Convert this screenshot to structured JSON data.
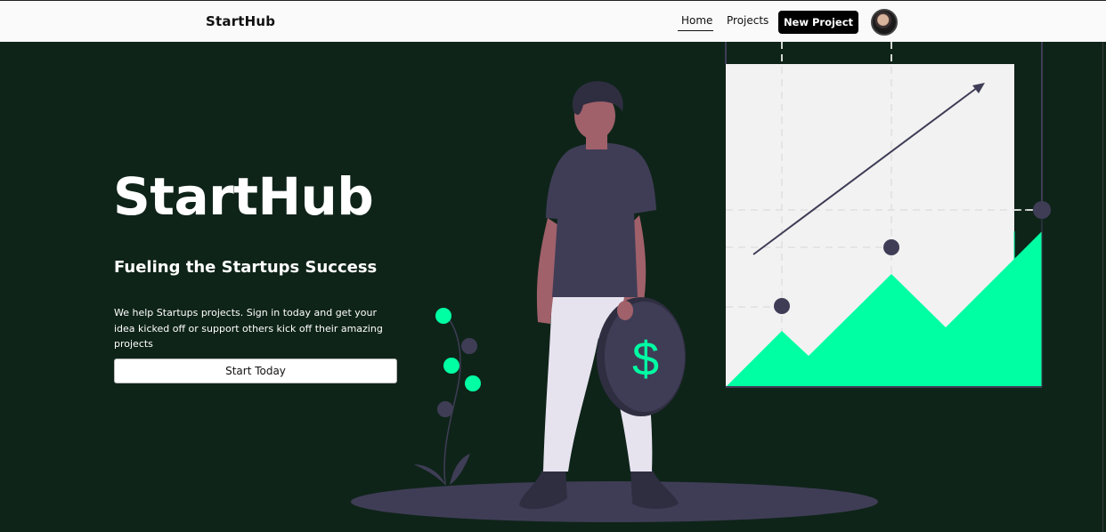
{
  "navbar": {
    "brand": "StartHub",
    "links": [
      {
        "label": "Home",
        "active": true
      },
      {
        "label": "Projects",
        "active": false
      }
    ],
    "new_project_label": "New Project"
  },
  "hero": {
    "title": "StartHub",
    "subtitle": "Fueling the Startups Success",
    "description": "We help Startups projects. Sign in today and get your idea kicked off or support others kick off their amazing projects",
    "cta_label": "Start Today"
  },
  "illustration": {
    "coin_symbol": "$"
  },
  "colors": {
    "background": "#0f2419",
    "accent_green": "#00ffa3",
    "figure_dark": "#3f3d56",
    "panel_light": "#f2f2f2"
  }
}
